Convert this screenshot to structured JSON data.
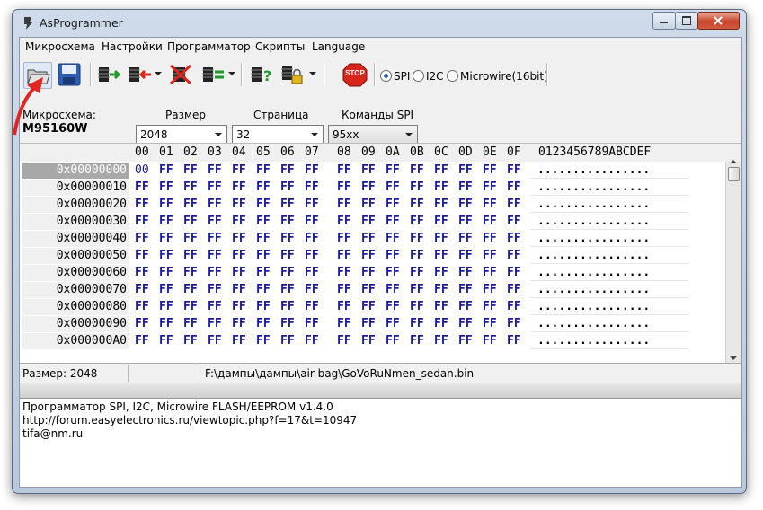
{
  "window": {
    "title": "AsProgrammer"
  },
  "menu": [
    "Микросхема",
    "Настройки",
    "Программатор",
    "Скрипты",
    "Language"
  ],
  "toolbar": {
    "icons": [
      "open-folder-icon",
      "save-icon",
      "read-chip-icon",
      "write-chip-icon",
      "erase-chip-icon",
      "verify-chip-icon",
      "read-id-icon",
      "lock-icon",
      "stop-icon"
    ],
    "stop_label": "STOP",
    "protocols": [
      {
        "label": "SPI",
        "checked": true
      },
      {
        "label": "I2C",
        "checked": false
      },
      {
        "label": "Microwire(16bit)",
        "checked": false
      }
    ]
  },
  "params": {
    "chip_label": "Микросхема:",
    "chip_value": "M95160W",
    "size_label": "Размер",
    "size_value": "2048",
    "page_label": "Страница",
    "page_value": "32",
    "spi_label": "Команды SPI",
    "spi_value": "95xx"
  },
  "grid": {
    "columns": [
      "00",
      "01",
      "02",
      "03",
      "04",
      "05",
      "06",
      "07",
      "08",
      "09",
      "0A",
      "0B",
      "0C",
      "0D",
      "0E",
      "0F"
    ],
    "ascii_header": "0123456789ABCDEF",
    "rows": [
      {
        "addr": "0x00000000",
        "bytes": [
          "00",
          "FF",
          "FF",
          "FF",
          "FF",
          "FF",
          "FF",
          "FF",
          "FF",
          "FF",
          "FF",
          "FF",
          "FF",
          "FF",
          "FF",
          "FF"
        ],
        "ascii": "................"
      },
      {
        "addr": "0x00000010",
        "bytes": [
          "FF",
          "FF",
          "FF",
          "FF",
          "FF",
          "FF",
          "FF",
          "FF",
          "FF",
          "FF",
          "FF",
          "FF",
          "FF",
          "FF",
          "FF",
          "FF"
        ],
        "ascii": "................"
      },
      {
        "addr": "0x00000020",
        "bytes": [
          "FF",
          "FF",
          "FF",
          "FF",
          "FF",
          "FF",
          "FF",
          "FF",
          "FF",
          "FF",
          "FF",
          "FF",
          "FF",
          "FF",
          "FF",
          "FF"
        ],
        "ascii": "................"
      },
      {
        "addr": "0x00000030",
        "bytes": [
          "FF",
          "FF",
          "FF",
          "FF",
          "FF",
          "FF",
          "FF",
          "FF",
          "FF",
          "FF",
          "FF",
          "FF",
          "FF",
          "FF",
          "FF",
          "FF"
        ],
        "ascii": "................"
      },
      {
        "addr": "0x00000040",
        "bytes": [
          "FF",
          "FF",
          "FF",
          "FF",
          "FF",
          "FF",
          "FF",
          "FF",
          "FF",
          "FF",
          "FF",
          "FF",
          "FF",
          "FF",
          "FF",
          "FF"
        ],
        "ascii": "................"
      },
      {
        "addr": "0x00000050",
        "bytes": [
          "FF",
          "FF",
          "FF",
          "FF",
          "FF",
          "FF",
          "FF",
          "FF",
          "FF",
          "FF",
          "FF",
          "FF",
          "FF",
          "FF",
          "FF",
          "FF"
        ],
        "ascii": "................"
      },
      {
        "addr": "0x00000060",
        "bytes": [
          "FF",
          "FF",
          "FF",
          "FF",
          "FF",
          "FF",
          "FF",
          "FF",
          "FF",
          "FF",
          "FF",
          "FF",
          "FF",
          "FF",
          "FF",
          "FF"
        ],
        "ascii": "................"
      },
      {
        "addr": "0x00000070",
        "bytes": [
          "FF",
          "FF",
          "FF",
          "FF",
          "FF",
          "FF",
          "FF",
          "FF",
          "FF",
          "FF",
          "FF",
          "FF",
          "FF",
          "FF",
          "FF",
          "FF"
        ],
        "ascii": "................"
      },
      {
        "addr": "0x00000080",
        "bytes": [
          "FF",
          "FF",
          "FF",
          "FF",
          "FF",
          "FF",
          "FF",
          "FF",
          "FF",
          "FF",
          "FF",
          "FF",
          "FF",
          "FF",
          "FF",
          "FF"
        ],
        "ascii": "................"
      },
      {
        "addr": "0x00000090",
        "bytes": [
          "FF",
          "FF",
          "FF",
          "FF",
          "FF",
          "FF",
          "FF",
          "FF",
          "FF",
          "FF",
          "FF",
          "FF",
          "FF",
          "FF",
          "FF",
          "FF"
        ],
        "ascii": "................"
      },
      {
        "addr": "0x000000A0",
        "bytes": [
          "FF",
          "FF",
          "FF",
          "FF",
          "FF",
          "FF",
          "FF",
          "FF",
          "FF",
          "FF",
          "FF",
          "FF",
          "FF",
          "FF",
          "FF",
          "FF"
        ],
        "ascii": "................"
      }
    ]
  },
  "status": {
    "size": "Размер: 2048",
    "middle": "",
    "path": "F:\\дампы\\дампы\\air bag\\GoVoRuNmen_sedan.bin"
  },
  "log": [
    "Программатор SPI, I2C, Microwire FLASH/EEPROM v1.4.0",
    "http://forum.easyelectronics.ru/viewtopic.php?f=17&t=10947",
    "tifa@nm.ru"
  ],
  "colors": {
    "hex_bytes": "#1a1a9e",
    "annotation_arrow": "#e0261e"
  }
}
